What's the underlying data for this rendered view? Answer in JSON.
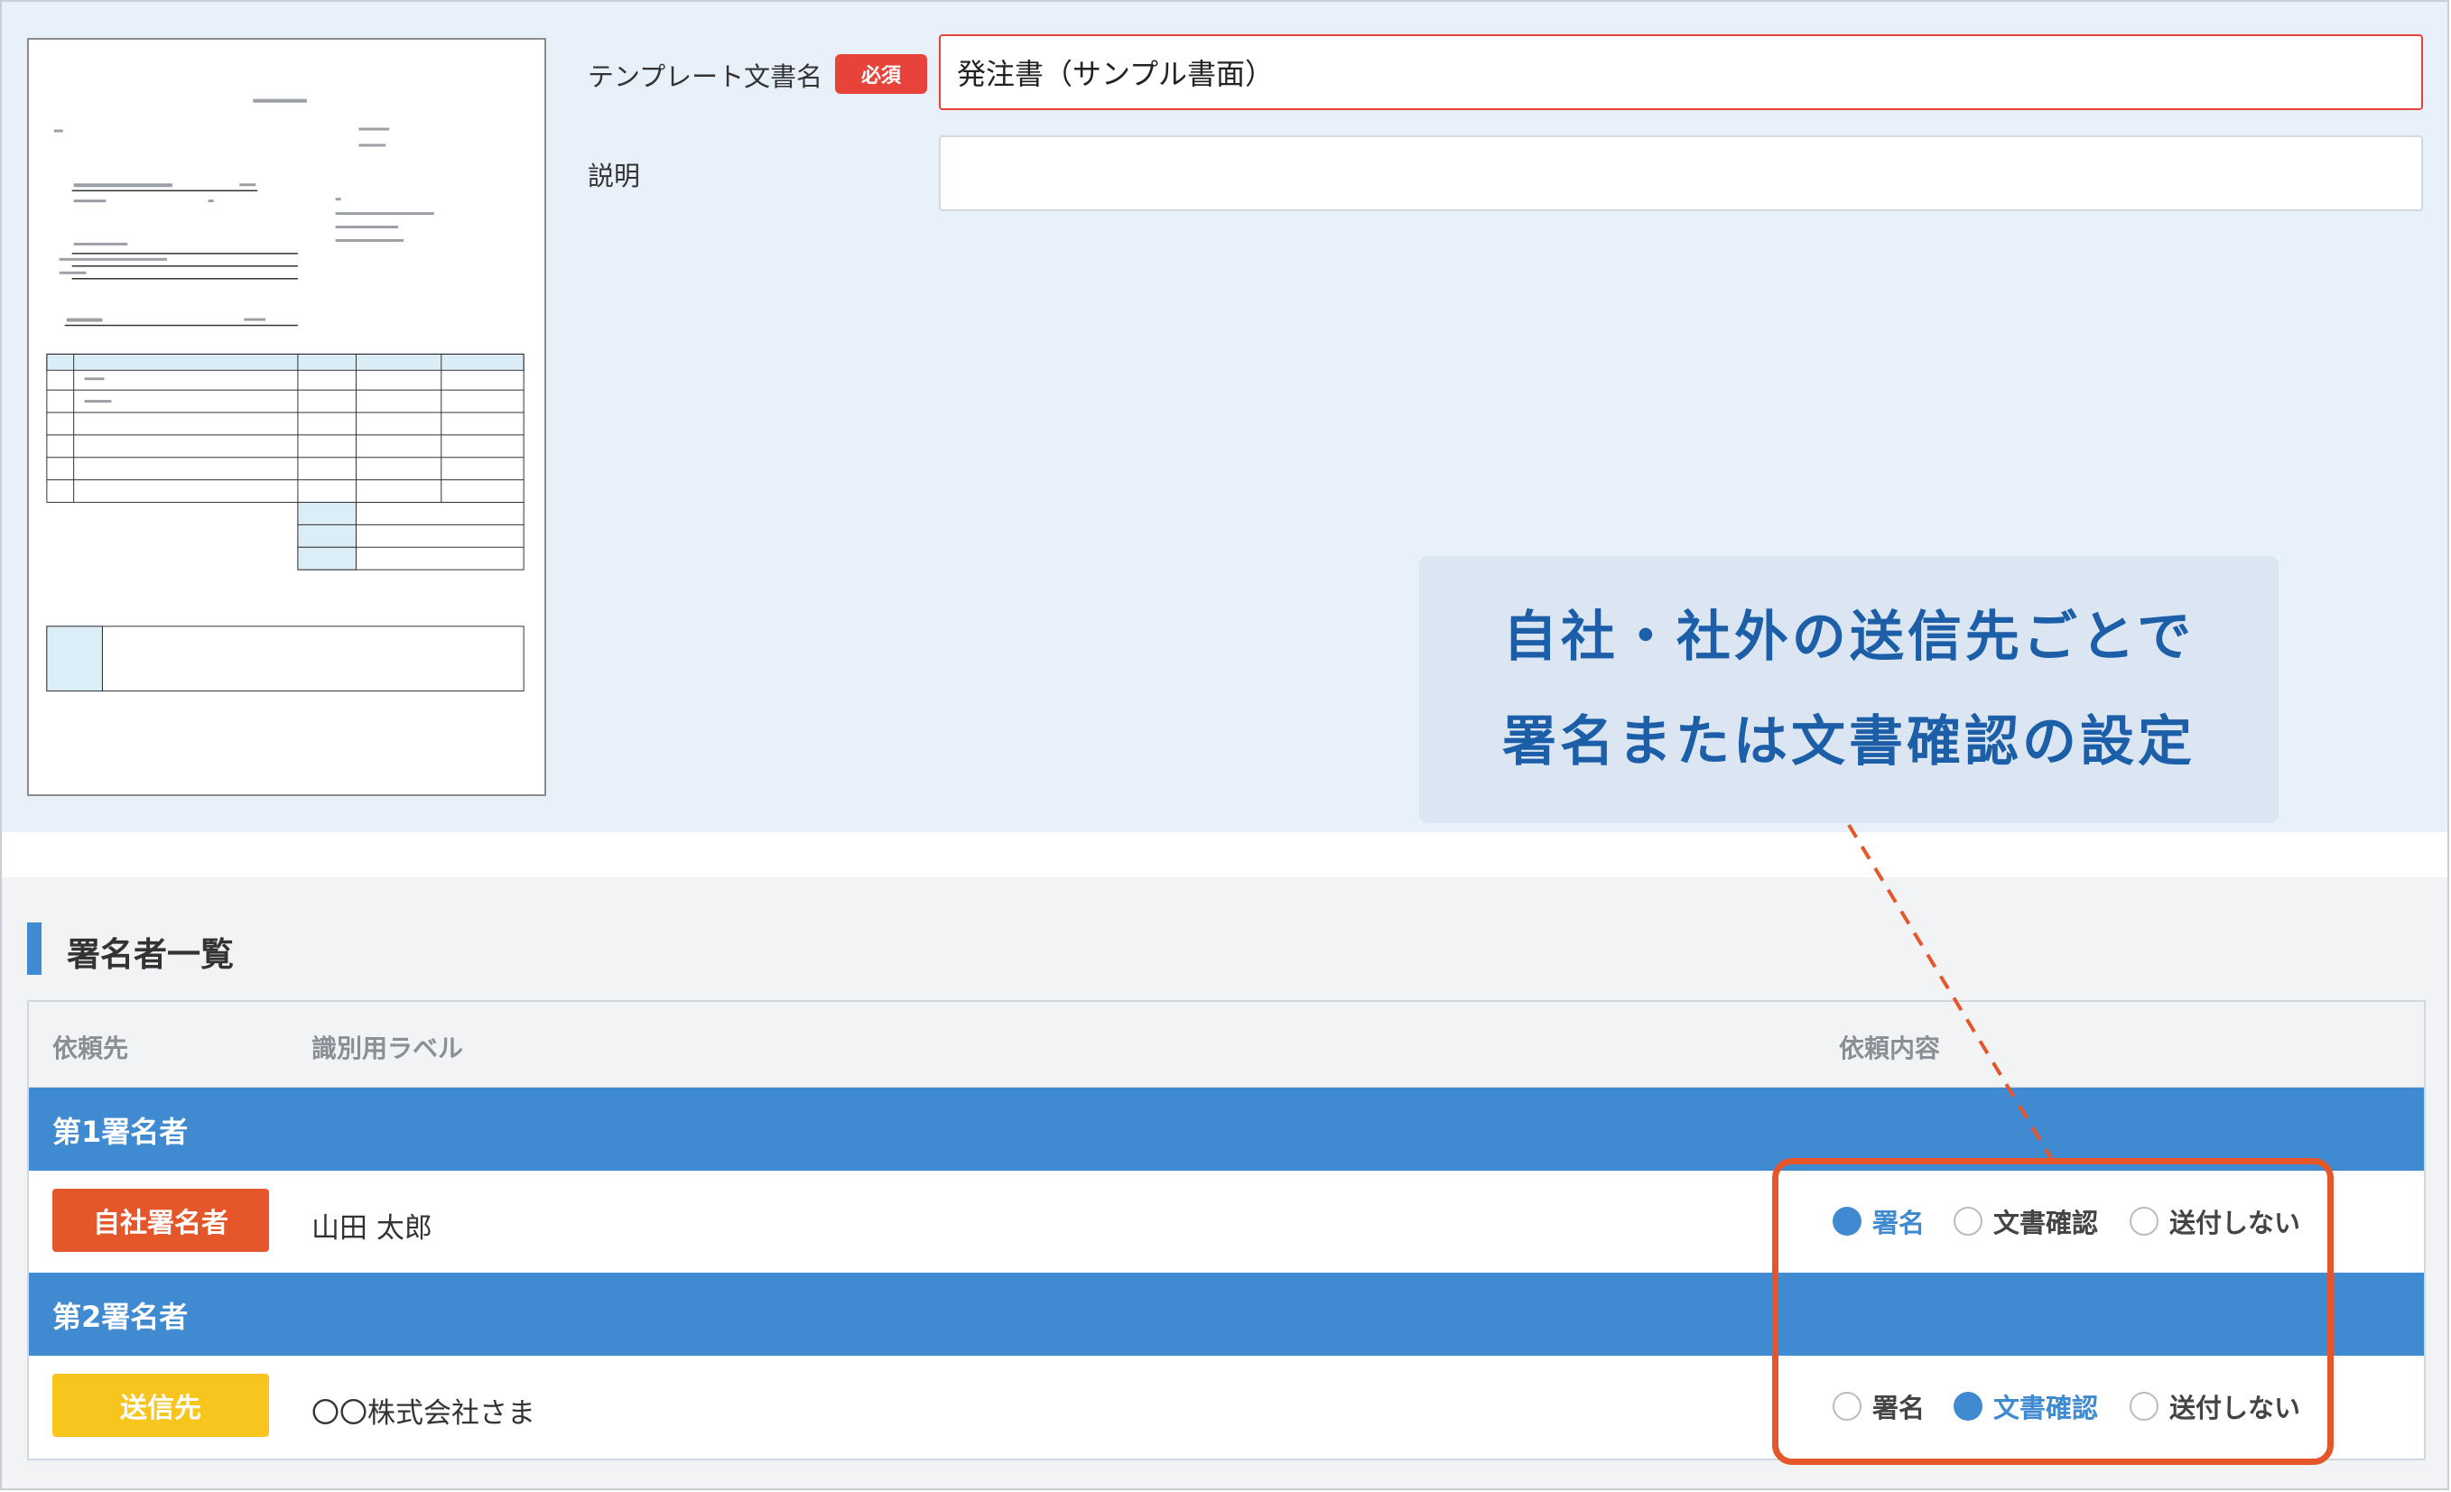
{
  "form": {
    "template_name_label": "テンプレート文書名",
    "required_badge": "必須",
    "template_name_value": "発注書（サンプル書面）",
    "description_label": "説明",
    "description_value": ""
  },
  "callout": {
    "line1": "自社・社外の送信先ごとで",
    "line2": "署名または文書確認の設定"
  },
  "signers_section": {
    "title": "署名者一覧",
    "columns": {
      "recipient": "依頼先",
      "label": "識別用ラベル",
      "request": "依頼内容"
    },
    "groups": [
      {
        "group_label": "第1署名者",
        "role_badge": "自社署名者",
        "role_color": "#e5562a",
        "name": "山田 太郎",
        "options": [
          "署名",
          "文書確認",
          "送付しない"
        ],
        "selected": "署名"
      },
      {
        "group_label": "第2署名者",
        "role_badge": "送信先",
        "role_color": "#f7c51e",
        "name": "〇〇株式会社さま",
        "options": [
          "署名",
          "文書確認",
          "送付しない"
        ],
        "selected": "文書確認"
      }
    ]
  },
  "colors": {
    "accent_blue": "#3f8ad0",
    "highlight_orange": "#e5562a",
    "required_red": "#e8433b",
    "callout_text": "#1c5fa8"
  }
}
